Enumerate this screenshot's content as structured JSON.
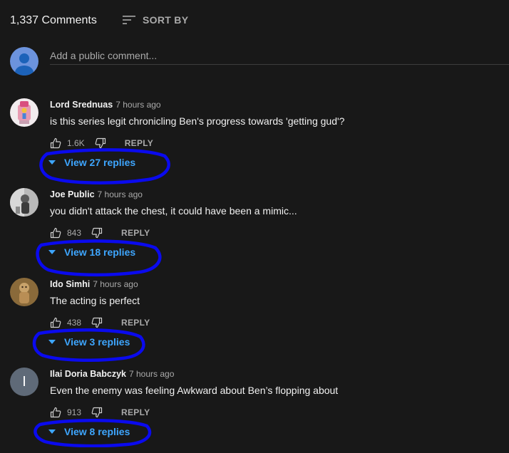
{
  "header": {
    "comment_count": "1,337 Comments",
    "sort_label": "SORT BY"
  },
  "add_comment": {
    "placeholder": "Add a public comment..."
  },
  "actions": {
    "reply_label": "REPLY"
  },
  "comments": [
    {
      "author": "Lord Srednuas",
      "time": "7 hours ago",
      "text": "is this series legit chronicling Ben's progress towards 'getting gud'?",
      "likes": "1.6K",
      "view_replies": "View 27 replies"
    },
    {
      "author": "Joe Public",
      "time": "7 hours ago",
      "text": "you didn't attack the chest, it could have been a mimic...",
      "likes": "843",
      "view_replies": "View 18 replies"
    },
    {
      "author": "Ido Simhi",
      "time": "7 hours ago",
      "text": "The acting is perfect",
      "likes": "438",
      "view_replies": "View 3 replies"
    },
    {
      "author": "Ilai Doria Babczyk",
      "time": "7 hours ago",
      "text": "Even the enemy was feeling Awkward about Ben’s flopping about",
      "likes": "913",
      "avatar_letter": "I",
      "view_replies": "View 8 replies"
    }
  ],
  "colors": {
    "background": "#181818",
    "link_blue": "#3ea6ff",
    "annotation_blue": "#0a0aee",
    "muted_text": "#aaaaaa"
  },
  "icons": {
    "sort": "sort-icon",
    "like": "thumb-up-icon",
    "dislike": "thumb-down-icon",
    "caret": "caret-down-icon"
  }
}
